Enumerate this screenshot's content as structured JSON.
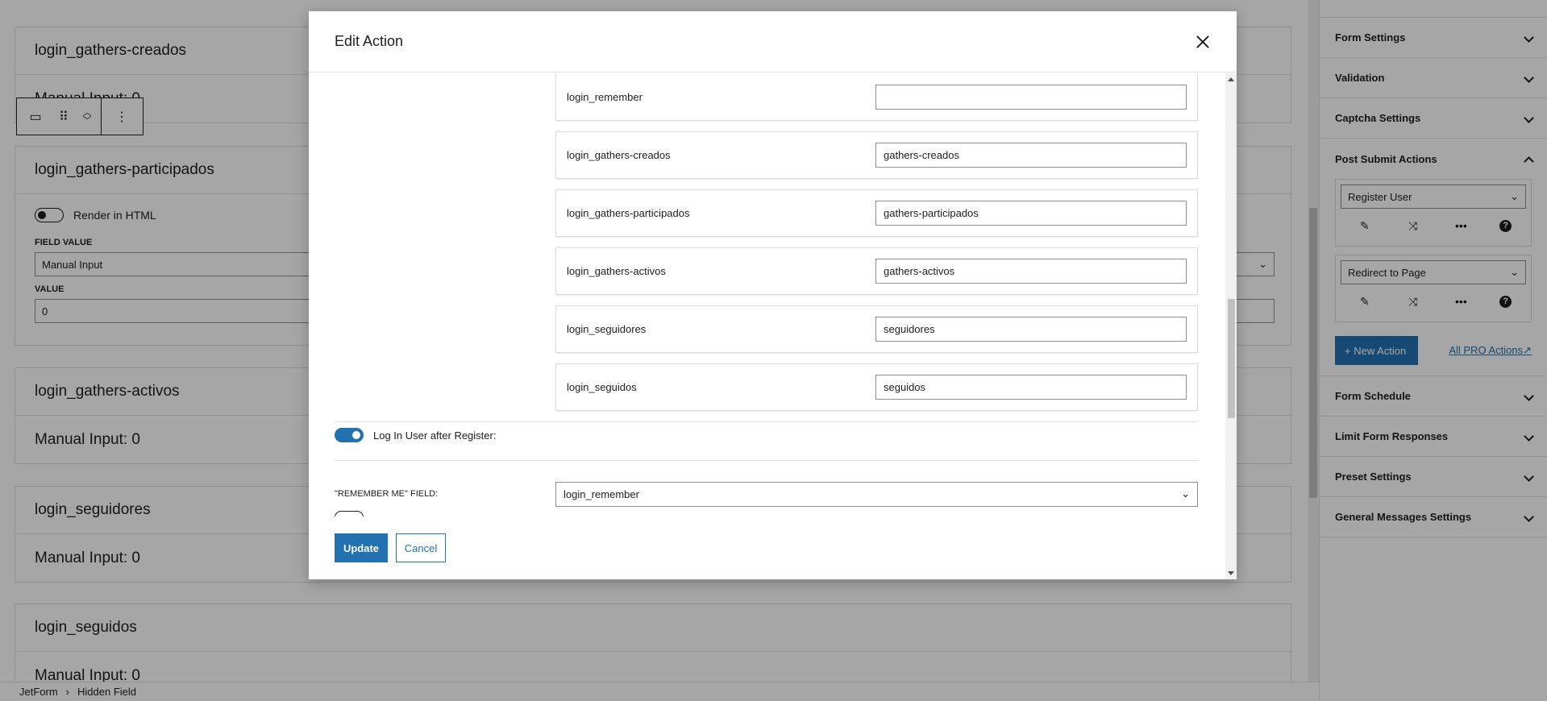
{
  "canvas": {
    "blocks": [
      {
        "title": "login_gathers-creados",
        "body": "Manual Input: 0"
      },
      {
        "title": "login_gathers-participados",
        "render_html": "Render in HTML",
        "field_value_label": "FIELD VALUE",
        "field_value": "Manual Input",
        "value_label": "VALUE",
        "value": "0"
      },
      {
        "title": "login_gathers-activos",
        "body": "Manual Input: 0"
      },
      {
        "title": "login_seguidores",
        "body": "Manual Input: 0"
      },
      {
        "title": "login_seguidos",
        "body": "Manual Input: 0"
      }
    ]
  },
  "breadcrumb": {
    "root": "JetForm",
    "separator": "›",
    "current": "Hidden Field"
  },
  "sidebar": {
    "panels_top": [
      "Form Settings",
      "Validation",
      "Captcha Settings"
    ],
    "post_submit": {
      "title": "Post Submit Actions",
      "actions": [
        "Register User",
        "Redirect to Page"
      ],
      "new_action": "+ New Action",
      "pro_link": "All PRO Actions"
    },
    "panels_bottom": [
      "Form Schedule",
      "Limit Form Responses",
      "Preset Settings",
      "General Messages Settings"
    ]
  },
  "modal": {
    "title": "Edit Action",
    "meta_rows": [
      {
        "label": "login_remember",
        "value": ""
      },
      {
        "label": "login_gathers-creados",
        "value": "gathers-creados"
      },
      {
        "label": "login_gathers-participados",
        "value": "gathers-participados"
      },
      {
        "label": "login_gathers-activos",
        "value": "gathers-activos"
      },
      {
        "label": "login_seguidores",
        "value": "seguidores"
      },
      {
        "label": "login_seguidos",
        "value": "seguidos"
      }
    ],
    "login_toggle_label": "Log In User after Register:",
    "login_toggle_on": true,
    "remember_label": "\"REMEMBER ME\" FIELD:",
    "remember_value": "login_remember",
    "update": "Update",
    "cancel": "Cancel"
  },
  "colors": {
    "accent": "#2271b1",
    "overlay": "rgba(0,0,0,0.35)"
  }
}
